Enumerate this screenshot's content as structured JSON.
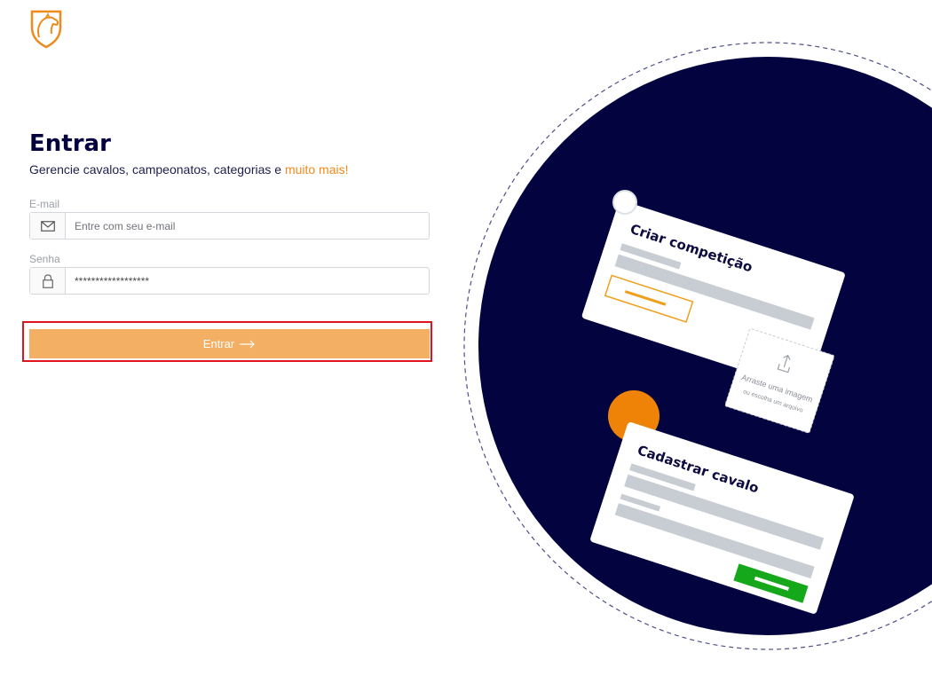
{
  "brand": {
    "logo_icon": "horse-head-shield-icon",
    "accent_color": "#ef8a1c"
  },
  "login": {
    "title": "Entrar",
    "subtitle_main": "Gerencie cavalos, campeonatos, categorias e ",
    "subtitle_accent": "muito mais!",
    "email": {
      "label": "E-mail",
      "placeholder": "Entre com seu e-mail",
      "value": "",
      "icon": "envelope-icon"
    },
    "password": {
      "label": "Senha",
      "placeholder": "",
      "value": "******************",
      "icon": "lock-icon"
    },
    "submit": {
      "label": "Entrar",
      "icon": "arrow-right-icon",
      "color": "#f3af63"
    }
  },
  "illustration": {
    "background_color": "#03033f",
    "card_competition_title": "Criar competição",
    "upload_text": "Arraste uma imagem",
    "upload_subtext": "ou escolha um arquivo",
    "upload_icon": "upload-icon",
    "card_horse_title": "Cadastrar cavalo"
  }
}
